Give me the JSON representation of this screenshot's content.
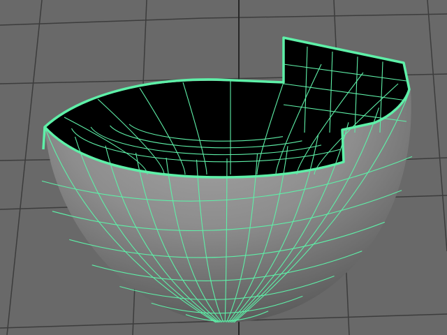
{
  "viewport": {
    "background_color": "#696969",
    "grid_color": "#3c3c3c",
    "grid_axis_color": "#262626",
    "grid_visible": true
  },
  "mesh": {
    "object_type": "partial-hemisphere",
    "selected": true,
    "wireframe_color": "#5ef0a8",
    "selection_outline_color": "#5ef0a8",
    "exterior_fill_color": "#9a9a9a",
    "exterior_shade_color": "#6e6e6e",
    "interior_fill_color": "#000000",
    "longitude_divisions": 20,
    "latitude_divisions": 8,
    "rim_cutout": "stepped"
  }
}
